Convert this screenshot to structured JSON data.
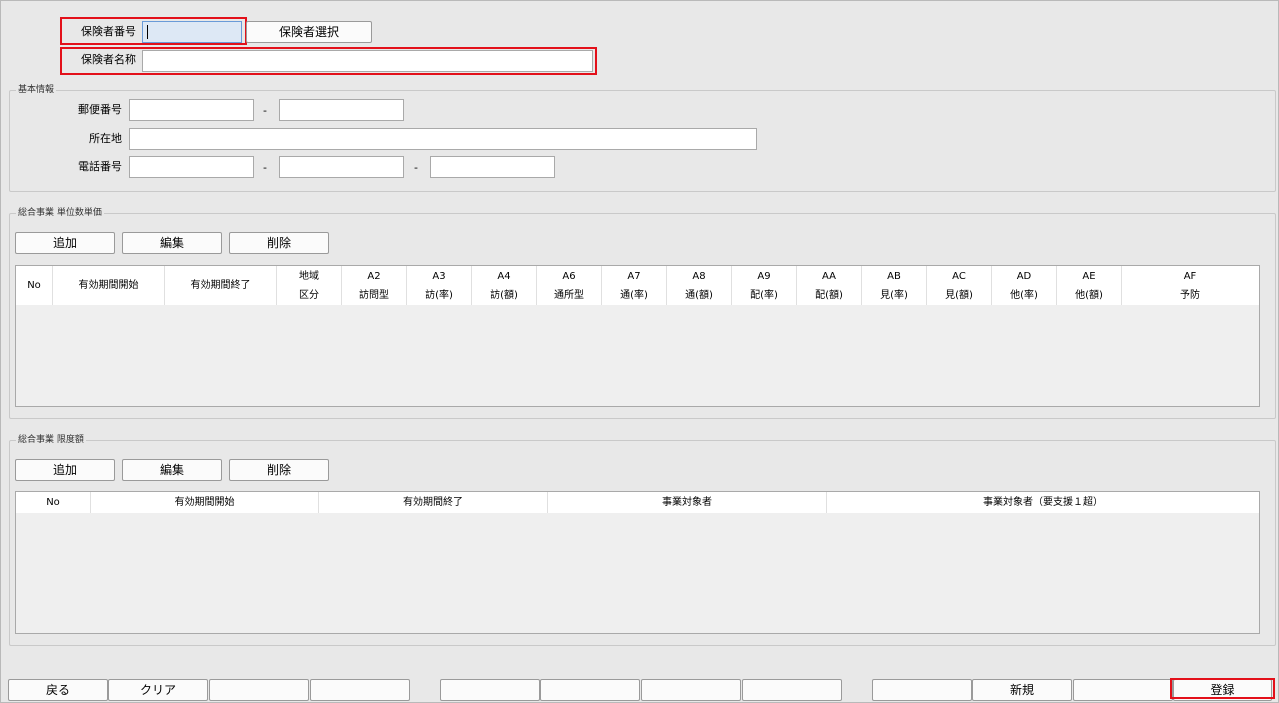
{
  "insurer": {
    "number_label": "保険者番号",
    "number_value": "",
    "select_button": "保険者選択",
    "name_label": "保険者名称",
    "name_value": ""
  },
  "basic": {
    "title": "基本情報",
    "postal_label": "郵便番号",
    "address_label": "所在地",
    "phone_label": "電話番号",
    "separator": "-"
  },
  "unit_price": {
    "title": "総合事業 単位数単価",
    "add": "追加",
    "edit": "編集",
    "delete": "削除",
    "columns": [
      {
        "l1": "No",
        "l2": ""
      },
      {
        "l1": "有効期間開始",
        "l2": ""
      },
      {
        "l1": "有効期間終了",
        "l2": ""
      },
      {
        "l1": "地域",
        "l2": "区分"
      },
      {
        "l1": "A2",
        "l2": "訪問型"
      },
      {
        "l1": "A3",
        "l2": "訪(率)"
      },
      {
        "l1": "A4",
        "l2": "訪(額)"
      },
      {
        "l1": "A6",
        "l2": "通所型"
      },
      {
        "l1": "A7",
        "l2": "通(率)"
      },
      {
        "l1": "A8",
        "l2": "通(額)"
      },
      {
        "l1": "A9",
        "l2": "配(率)"
      },
      {
        "l1": "AA",
        "l2": "配(額)"
      },
      {
        "l1": "AB",
        "l2": "見(率)"
      },
      {
        "l1": "AC",
        "l2": "見(額)"
      },
      {
        "l1": "AD",
        "l2": "他(率)"
      },
      {
        "l1": "AE",
        "l2": "他(額)"
      },
      {
        "l1": "AF",
        "l2": "予防"
      }
    ]
  },
  "limit": {
    "title": "総合事業 限度額",
    "add": "追加",
    "edit": "編集",
    "delete": "削除",
    "columns": [
      "No",
      "有効期間開始",
      "有効期間終了",
      "事業対象者",
      "事業対象者（要支援１超）"
    ]
  },
  "footer": {
    "back": "戻る",
    "clear": "クリア",
    "new": "新規",
    "register": "登録"
  },
  "colors": {
    "highlight": "#e3101a",
    "background": "#e8e8e8"
  }
}
